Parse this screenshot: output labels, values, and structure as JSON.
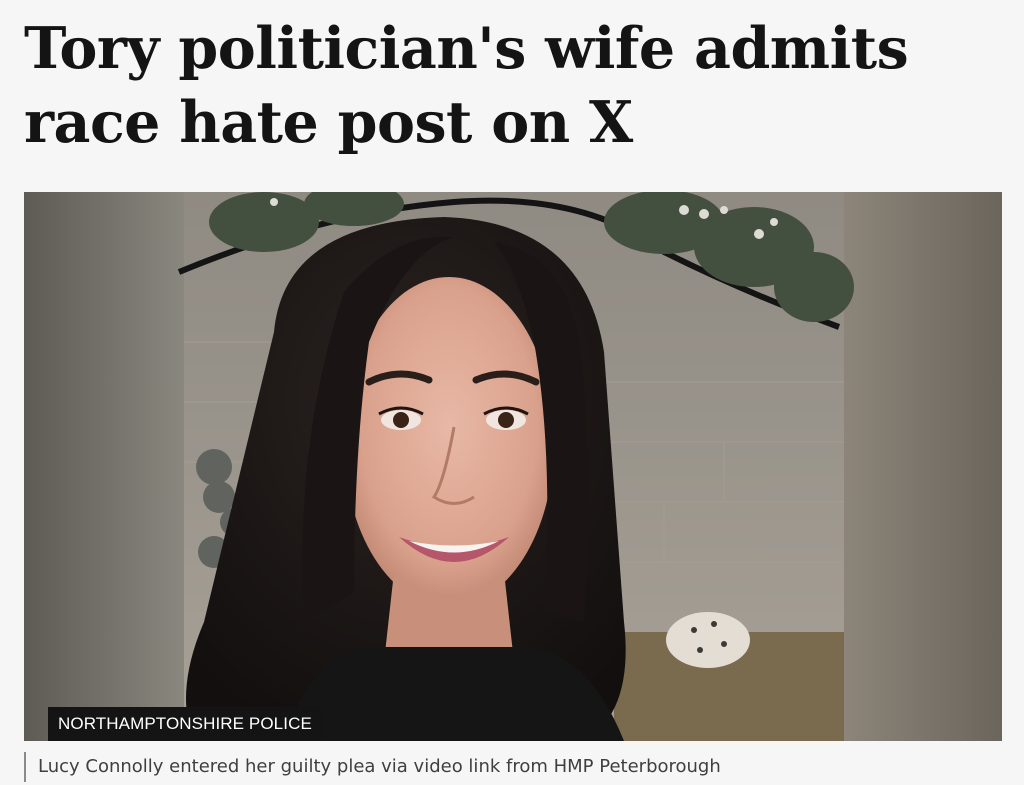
{
  "article": {
    "headline_line1": "Tory politician's wife admits",
    "headline_line2": "race hate post on X",
    "image": {
      "credit": "NORTHAMPTONSHIRE POLICE",
      "caption": "Lucy Connolly entered her guilty plea via video link from HMP Peterborough"
    }
  }
}
